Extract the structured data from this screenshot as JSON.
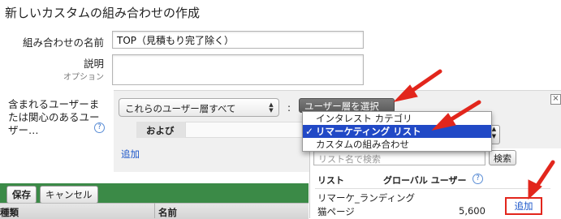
{
  "page_title": "新しいカスタムの組み合わせの作成",
  "form": {
    "name_label": "組み合わせの名前",
    "name_value": "TOP（見積もり完了除く）",
    "desc_label": "説明",
    "desc_sub": "オプション",
    "desc_value": "",
    "include_label_1": "含まれるユーザーま",
    "include_label_2": "たは関心のあるユー",
    "include_label_3": "ザー…",
    "help_icon": "?"
  },
  "rule": {
    "condition_select": "これらのユーザー層すべて",
    "colon": ":",
    "picker_button": "ユーザー層を選択",
    "and_label": "および",
    "add_link": "追加",
    "close_icon": "×"
  },
  "dropdown": {
    "items": [
      {
        "label": "インタレスト カテゴリ",
        "selected": false
      },
      {
        "label": "リマーケティング リスト",
        "selected": true
      },
      {
        "label": "カスタムの組み合わせ",
        "selected": false
      }
    ],
    "check": "✓"
  },
  "list_panel": {
    "search_placeholder": "リスト名で検索",
    "search_button": "検索",
    "col_list": "リスト",
    "col_global": "グローバル ユーザー",
    "help_icon": "?",
    "rows": [
      {
        "name_line1": "リマーケ_ランディング",
        "name_line2": "猫ページ",
        "users": "5,600",
        "action": "追加"
      }
    ]
  },
  "actions": {
    "save": "保存",
    "cancel": "キャンセル"
  },
  "table_header": {
    "col_type": "種類",
    "col_name": "名前"
  },
  "colors": {
    "accent_green": "#3b8a47",
    "selection_blue": "#2149c6",
    "annotation_red": "#e2261c",
    "link": "#1a55c9"
  }
}
